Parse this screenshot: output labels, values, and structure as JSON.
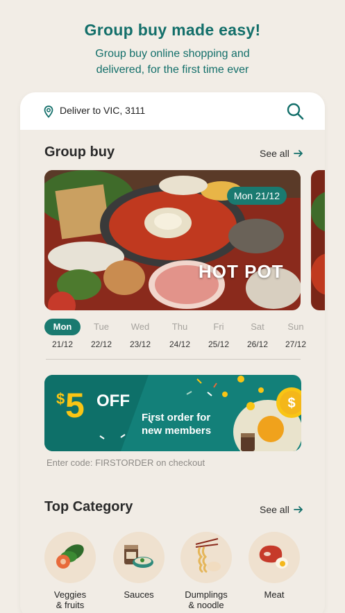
{
  "hero": {
    "title": "Group buy made easy!",
    "subtitle": "Group buy online shopping and delivered, for the first time ever"
  },
  "location": {
    "label": "Deliver to VIC, 3111",
    "icon": "location-pin-icon"
  },
  "search": {
    "icon": "search-icon"
  },
  "group_buy": {
    "title": "Group buy",
    "see_all": "See all",
    "banner": {
      "date": "Mon 21/12",
      "label": "HOT POT"
    }
  },
  "days": [
    {
      "name": "Mon",
      "date": "21/12",
      "active": true
    },
    {
      "name": "Tue",
      "date": "22/12",
      "active": false
    },
    {
      "name": "Wed",
      "date": "23/12",
      "active": false
    },
    {
      "name": "Thu",
      "date": "24/12",
      "active": false
    },
    {
      "name": "Fri",
      "date": "25/12",
      "active": false
    },
    {
      "name": "Sat",
      "date": "26/12",
      "active": false
    },
    {
      "name": "Sun",
      "date": "27/12",
      "active": false
    }
  ],
  "promo": {
    "currency": "$",
    "amount": "5",
    "off": "OFF",
    "text": "First order for new members",
    "code_note": "Enter code: FIRSTORDER on checkout"
  },
  "top_category": {
    "title": "Top Category",
    "see_all": "See all",
    "items": [
      {
        "label": "Veggies\n& fruits",
        "icon": "veggies-icon"
      },
      {
        "label": "Sauces",
        "icon": "sauce-jar-icon"
      },
      {
        "label": "Dumplings\n& noodle",
        "icon": "noodles-icon"
      },
      {
        "label": "Meat",
        "icon": "meat-icon"
      }
    ]
  },
  "colors": {
    "brand": "#136f6a",
    "accent": "#f9c514",
    "background": "#f2ede6"
  }
}
